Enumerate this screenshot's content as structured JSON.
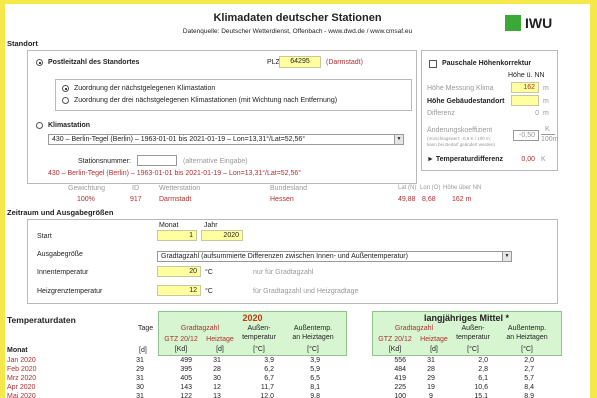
{
  "header": {
    "title": "Klimadaten deutscher Stationen",
    "subtitle": "Datenquelle: Deutscher Wetterdienst, Offenbach - www.dwd.de / www.cmsaf.eu",
    "logo_text": "IWU"
  },
  "standort": {
    "heading": "Standort",
    "radio_plz_label": "Postleitzahl des Standortes",
    "plz_label": "PLZ",
    "plz_value": "64295",
    "plz_city": "(Darmstadt)",
    "radio_near_one": "Zuordnung der nächstgelegenen Klimastation",
    "radio_near_three": "Zuordnung der drei nächstgelegenen Klimastationen (mit Wichtung nach Entfernung)",
    "radio_klimastation_label": "Klimastation",
    "station_select_value": "430  –  Berlin-Tegel (Berlin)  –  1963-01-01 bis 2021-01-19  –  Lon=13,31°/Lat=52,56°",
    "stationsnummer_label": "Stationsnummer:",
    "stationsnummer_hint": "(alternative Eingabe)",
    "station_info_line": "430  –  Berlin-Tegel (Berlin)  –  1963-01-01 bis 2021-01-19  –  Lon=13,31°/Lat=52,56°"
  },
  "hoehe": {
    "checkbox_label": "Pauschale Höhenkorrektur",
    "col_header": "Höhe ü. NN",
    "messung_label": "Höhe Messung Klima",
    "messung_value": "162",
    "messung_unit": "m",
    "gebaeude_label": "Höhe Gebäudestandort",
    "gebaeude_value": "",
    "gebaeude_unit": "m",
    "differenz_label": "Differenz",
    "differenz_value": "0",
    "differenz_unit": "m",
    "koeff_label": "Änderungskoeffizient",
    "koeff_sub1": "(Vorschlagswert: -0,5 K / 100 m;",
    "koeff_sub2": "kann bei Bedarf geändert werden)",
    "koeff_value": "-0,50",
    "koeff_unit_top": "K",
    "koeff_unit_bottom": "100m",
    "tempdiff_label": "► Temperaturdifferenz",
    "tempdiff_value": "0,00",
    "tempdiff_unit": "K"
  },
  "wichtung": {
    "headers": [
      "Gewichtung",
      "ID",
      "Wetterstation",
      "Bundesland",
      "Lat (N)",
      "Lon (O)",
      "Höhe über NN"
    ],
    "row": [
      "100%",
      "917",
      "Darmstadt",
      "Hessen",
      "49,88",
      "8,68",
      "162 m"
    ]
  },
  "zeitraum": {
    "heading": "Zeitraum und Ausgabegrößen",
    "monat_label": "Monat",
    "jahr_label": "Jahr",
    "start_label": "Start",
    "start_monat": "1",
    "start_jahr": "2020",
    "ausgabe_label": "Ausgabegröße",
    "ausgabe_value": "Gradtagzahl (aufsummierte Differenzen zwischen Innen- und Außentemperatur)",
    "innen_label": "Innentemperatur",
    "innen_value": "20",
    "innen_unit": "°C",
    "innen_hint": "nur für Gradtagzahl",
    "heizgrenz_label": "Heizgrenztemperatur",
    "heizgrenz_value": "12",
    "heizgrenz_unit": "°C",
    "heizgrenz_hint": "für Gradtagzahl und Heizgradtage"
  },
  "table": {
    "heading": "Temperaturdaten",
    "tage_label": "Tage",
    "monat_label": "Monat",
    "tage_unit": "[d]",
    "year_title": "2020",
    "mittel_title": "langjähriges Mittel *",
    "gradtagzahl_label": "Gradtagzahl",
    "gtz_label": "GTZ 20/12",
    "heiztage_label": "Heiztage",
    "aussen_temp_1": "Außen-",
    "aussen_temp_2": "temperatur",
    "aussen_heiz_1": "Außentemp.",
    "aussen_heiz_2": "an Heiztagen",
    "unit_kd": "[Kd]",
    "unit_d": "[d]",
    "unit_c": "[°C]",
    "rows": [
      {
        "monat": "Jan 2020",
        "tage": "31",
        "y": [
          "499",
          "31",
          "3,9",
          "3,9"
        ],
        "m": [
          "556",
          "31",
          "2,0",
          "2,0"
        ]
      },
      {
        "monat": "Feb 2020",
        "tage": "29",
        "y": [
          "395",
          "28",
          "6,2",
          "5,9"
        ],
        "m": [
          "484",
          "28",
          "2,8",
          "2,7"
        ]
      },
      {
        "monat": "Mrz 2020",
        "tage": "31",
        "y": [
          "405",
          "30",
          "6,7",
          "6,5"
        ],
        "m": [
          "419",
          "29",
          "6,1",
          "5,7"
        ]
      },
      {
        "monat": "Apr 2020",
        "tage": "30",
        "y": [
          "143",
          "12",
          "11,7",
          "8,1"
        ],
        "m": [
          "225",
          "19",
          "10,6",
          "8,4"
        ]
      },
      {
        "monat": "Mai 2020",
        "tage": "31",
        "y": [
          "122",
          "13",
          "12,0",
          "9,8"
        ],
        "m": [
          "100",
          "9",
          "15,1",
          "8,9"
        ]
      }
    ]
  }
}
